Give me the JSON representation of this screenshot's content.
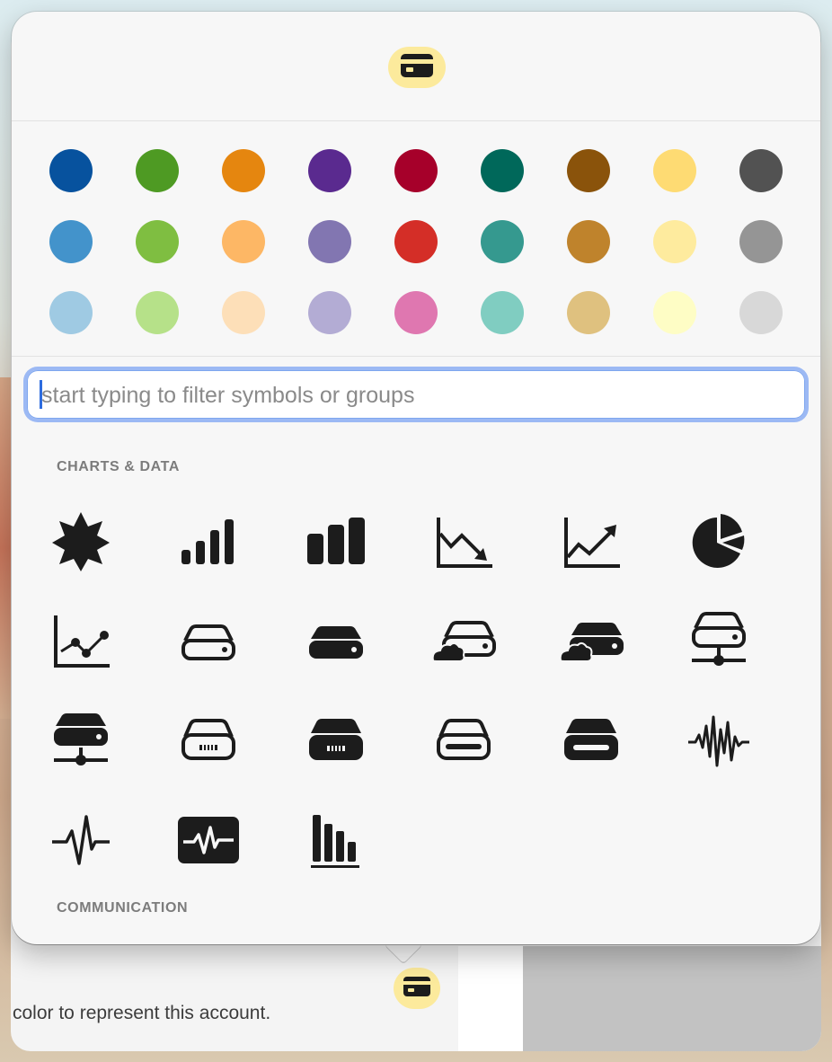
{
  "popover": {
    "selected_icon": "creditcard-icon",
    "search_placeholder": "start typing to filter symbols or groups",
    "colors": [
      [
        "#07529e",
        "#4e9a23",
        "#e5860f",
        "#5a2a8f",
        "#a6002a",
        "#00685a",
        "#8a530b",
        "#fedb73",
        "#525252"
      ],
      [
        "#4393cb",
        "#7fbe41",
        "#fdb765",
        "#8276b1",
        "#d42e27",
        "#35998f",
        "#bf832c",
        "#feeb9e",
        "#959595"
      ],
      [
        "#9fcae3",
        "#b6e189",
        "#fddfb8",
        "#b3acd4",
        "#df77b0",
        "#80cdc1",
        "#dfc17f",
        "#fefdc5",
        "#d8d8d8"
      ]
    ],
    "sections": [
      {
        "title": "CHARTS & DATA",
        "symbols": [
          "seal-icon",
          "cellularbars-icon",
          "chart-bar-fill-icon",
          "chart-line-downtrend-icon",
          "chart-line-uptrend-icon",
          "chart-pie-fill-icon",
          "chart-xyaxis-line-icon",
          "internaldrive-icon",
          "internaldrive-fill-icon",
          "externaldrive-badge-icloud-icon",
          "externaldrive-fill-badge-icloud-icon",
          "server-rack-network-icon",
          "server-rack-network-fill-icon",
          "opticaldiscdrive-icon",
          "opticaldiscdrive-fill-icon",
          "externaldrive-icon",
          "externaldrive-fill-icon",
          "waveform-path-icon",
          "waveform-path-ecg-icon",
          "waveform-path-ecg-rectangle-fill-icon",
          "chart-bar-xaxis-icon"
        ]
      },
      {
        "title": "COMMUNICATION",
        "symbols": []
      }
    ]
  },
  "background_window": {
    "caption": "color to represent this account.",
    "icon": "creditcard-icon"
  }
}
